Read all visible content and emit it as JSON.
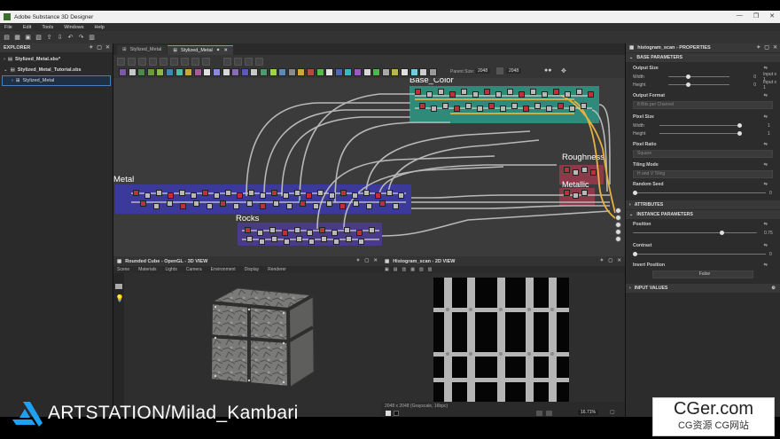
{
  "window": {
    "title": "Adobe Substance 3D Designer",
    "buttons": [
      "—",
      "❐",
      "✕"
    ]
  },
  "menubar": [
    "File",
    "Edit",
    "Tools",
    "Windows",
    "Help"
  ],
  "explorer": {
    "title": "EXPLORER",
    "items": [
      "Stylized_Metal.sbs*",
      "Stylized_Metal_Tutorial.sbs",
      "Stylized_Metal"
    ]
  },
  "graph": {
    "tabs": [
      "Stylized_Metal",
      "Stylized_Metal"
    ],
    "parent_size_label": "Parent Size:",
    "parent_size_value": "2048",
    "size_value": "2048",
    "frames": {
      "base_color": "Base_Color",
      "roughness": "Roughness",
      "metallic": "Metallic",
      "metal": "Metal",
      "rocks": "Rocks"
    }
  },
  "view3d": {
    "title": "Rounded Cube - OpenGL - 3D VIEW",
    "menu": [
      "Scene",
      "Materials",
      "Lights",
      "Camera",
      "Environment",
      "Display",
      "Renderer"
    ]
  },
  "view2d": {
    "title": "Histogram_scan - 2D VIEW",
    "status": "2048 x 2048 (Grayscale, 16bpc)",
    "zoom": "16.71%"
  },
  "properties": {
    "title": "histogram_scan - PROPERTIES",
    "base_parameters": "BASE PARAMETERS",
    "output_size": "Output Size",
    "width_label": "Width",
    "height_label": "Height",
    "output_width_value": "0",
    "output_height_value": "0",
    "input_mult_w": "Input x 1",
    "input_mult_h": "Input x 1",
    "output_format": "Output Format",
    "output_format_value": "8 Bits per Channel",
    "pixel_size": "Pixel Size",
    "pixel_width_value": "1",
    "pixel_height_value": "1",
    "pixel_ratio": "Pixel Ratio",
    "pixel_ratio_value": "Square",
    "tiling_mode": "Tiling Mode",
    "tiling_mode_value": "H and V Tiling",
    "random_seed": "Random Seed",
    "random_seed_value": "0",
    "attributes": "ATTRIBUTES",
    "instance_parameters": "INSTANCE PARAMETERS",
    "position_label": "Position",
    "position_value": "0.75",
    "contrast_label": "Contrast",
    "contrast_value": "0",
    "invert_position": "Invert Position",
    "invert_value": "False",
    "input_values": "INPUT VALUES"
  },
  "watermark": {
    "text": "ARTSTATION/Milad_Kambari"
  },
  "cger": {
    "big": "CGer.com",
    "small": "CG资源 CG网站"
  },
  "colors": {
    "accent": "#4a7fbf",
    "base_color_frame": "#2f8a7a",
    "metal_frame": "#3b3a9a",
    "rocks_frame": "#4a3a8a",
    "rough_frame": "#8c3a4a"
  }
}
